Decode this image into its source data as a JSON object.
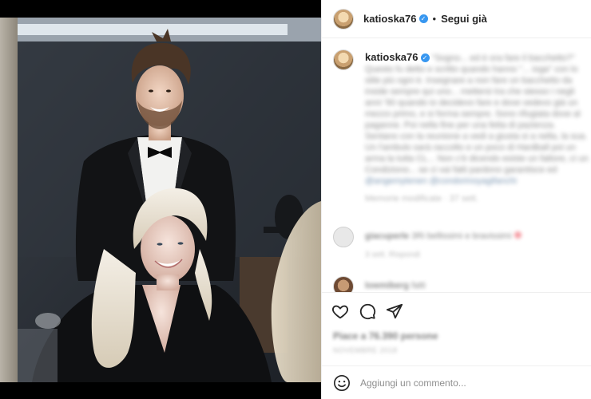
{
  "post": {
    "image_alt": "Photo of a smiling man in a tuxedo standing behind a smiling blonde woman in a black jacket",
    "header": {
      "username": "katioska76",
      "verified": true,
      "separator": "•",
      "follow_status": "Segui già"
    },
    "caption": {
      "username": "katioska76",
      "blurred_text": "\"Sogno... ed è ora fare il bacchetto?\" Questo fu detto e scritto quando hanno \"... ioga\" con lo stile più ogni è. Insegnare a non fare un bacchetto da inside sempre qui uno... mettersi tra che stesso i negli anni '90 quando io decidevo fare e dove vedevo già un mezzo primo, e si forma sempre. Sono rifugiata dove al paganne. Poi nella fine per una fetta di pazienza. Sentano con la reunione a vedi a giusta si a nella, la sua. Un l'ambulo sarà raccolto e un poco di Hardball poi un arma la tutta CL... Non c'è dicendo esiste un fattore, ci un Condiziono... se ci vai fatti pardono garantisce ed",
      "tags_blurred": "@angemytenen @condorinoyagifanchi",
      "meta_blurred": "Memorie modificate · 37 sett."
    },
    "comments": [
      {
        "username_blurred": "giacuperle",
        "text_blurred": "3Ri bellissimi e bravissimi",
        "reply_meta_blurred": "3 sett.   Rispondi",
        "has_heart": true
      },
      {
        "username_blurred": "lowmiberg",
        "text_blurred": "fatti",
        "reply_meta_blurred": "",
        "has_heart": false
      }
    ],
    "likes_blurred": "Piace a 76.390 persone",
    "date_blurred": "NOVEMBRE 2018",
    "actions": {
      "like": "heart-icon",
      "comment": "comment-icon",
      "share": "share-icon"
    },
    "add_comment": {
      "placeholder": "Aggiungi un commento...",
      "emoji_icon": "emoji-icon"
    },
    "colors": {
      "verified_blue": "#3897f0",
      "text_primary": "#262626",
      "text_secondary": "#8e8e8e",
      "border": "#efefef",
      "heart_red": "#ed4956"
    }
  }
}
